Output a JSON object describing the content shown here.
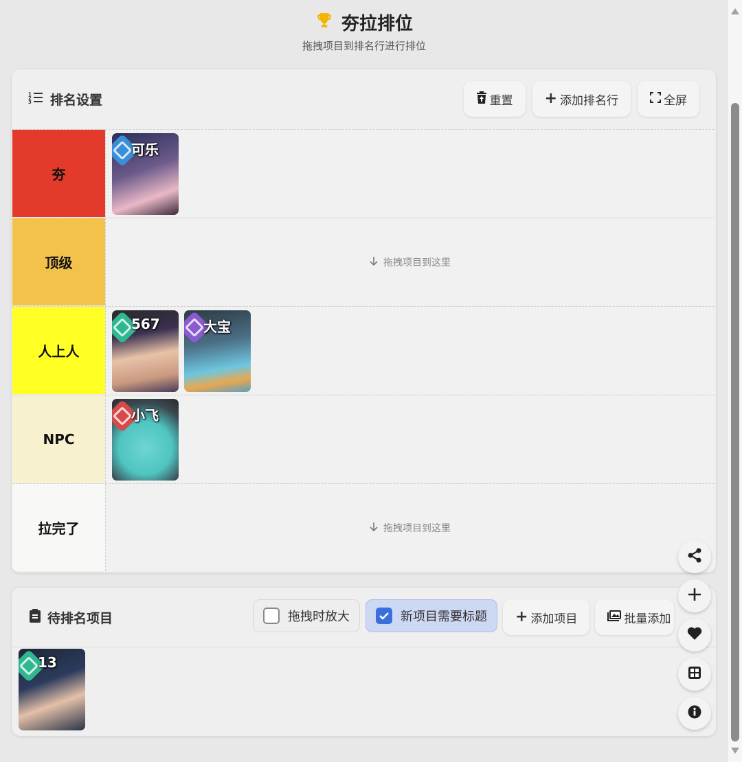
{
  "header": {
    "title": "夯拉排位",
    "subtitle": "拖拽项目到排名行进行排位"
  },
  "ranking": {
    "title": "排名设置",
    "buttons": {
      "reset": "重置",
      "add_row": "添加排名行",
      "fullscreen": "全屏"
    },
    "tiers": [
      {
        "label": "夯",
        "color": "#e33a2c"
      },
      {
        "label": "顶级",
        "color": "#f2c24b"
      },
      {
        "label": "人上人",
        "color": "#ffff24"
      },
      {
        "label": "NPC",
        "color": "#f8f1cf"
      },
      {
        "label": "拉完了",
        "color": "#f8f8f6"
      }
    ],
    "drop_hint": "拖拽项目到这里",
    "items": {
      "t0_0": {
        "name": "可乐",
        "badge_color": "#3a8fd8"
      },
      "t2_0": {
        "name": "567",
        "badge_color": "#2fb890"
      },
      "t2_1": {
        "name": "大宝",
        "badge_color": "#8a5ad0"
      },
      "t3_0": {
        "name": "小飞",
        "badge_color": "#d64a4a"
      }
    }
  },
  "pending": {
    "title": "待排名项目",
    "toggles": {
      "zoom_on_drag": {
        "label": "拖拽时放大",
        "checked": false
      },
      "require_title": {
        "label": "新项目需要标题",
        "checked": true
      }
    },
    "buttons": {
      "add_item": "添加项目",
      "batch_add": "批量添加"
    },
    "items": {
      "p0": {
        "name": "13",
        "badge_color": "#2fb890"
      }
    }
  },
  "fabs": [
    "share-icon",
    "plus-icon",
    "heart-icon",
    "grid-icon",
    "info-icon"
  ]
}
